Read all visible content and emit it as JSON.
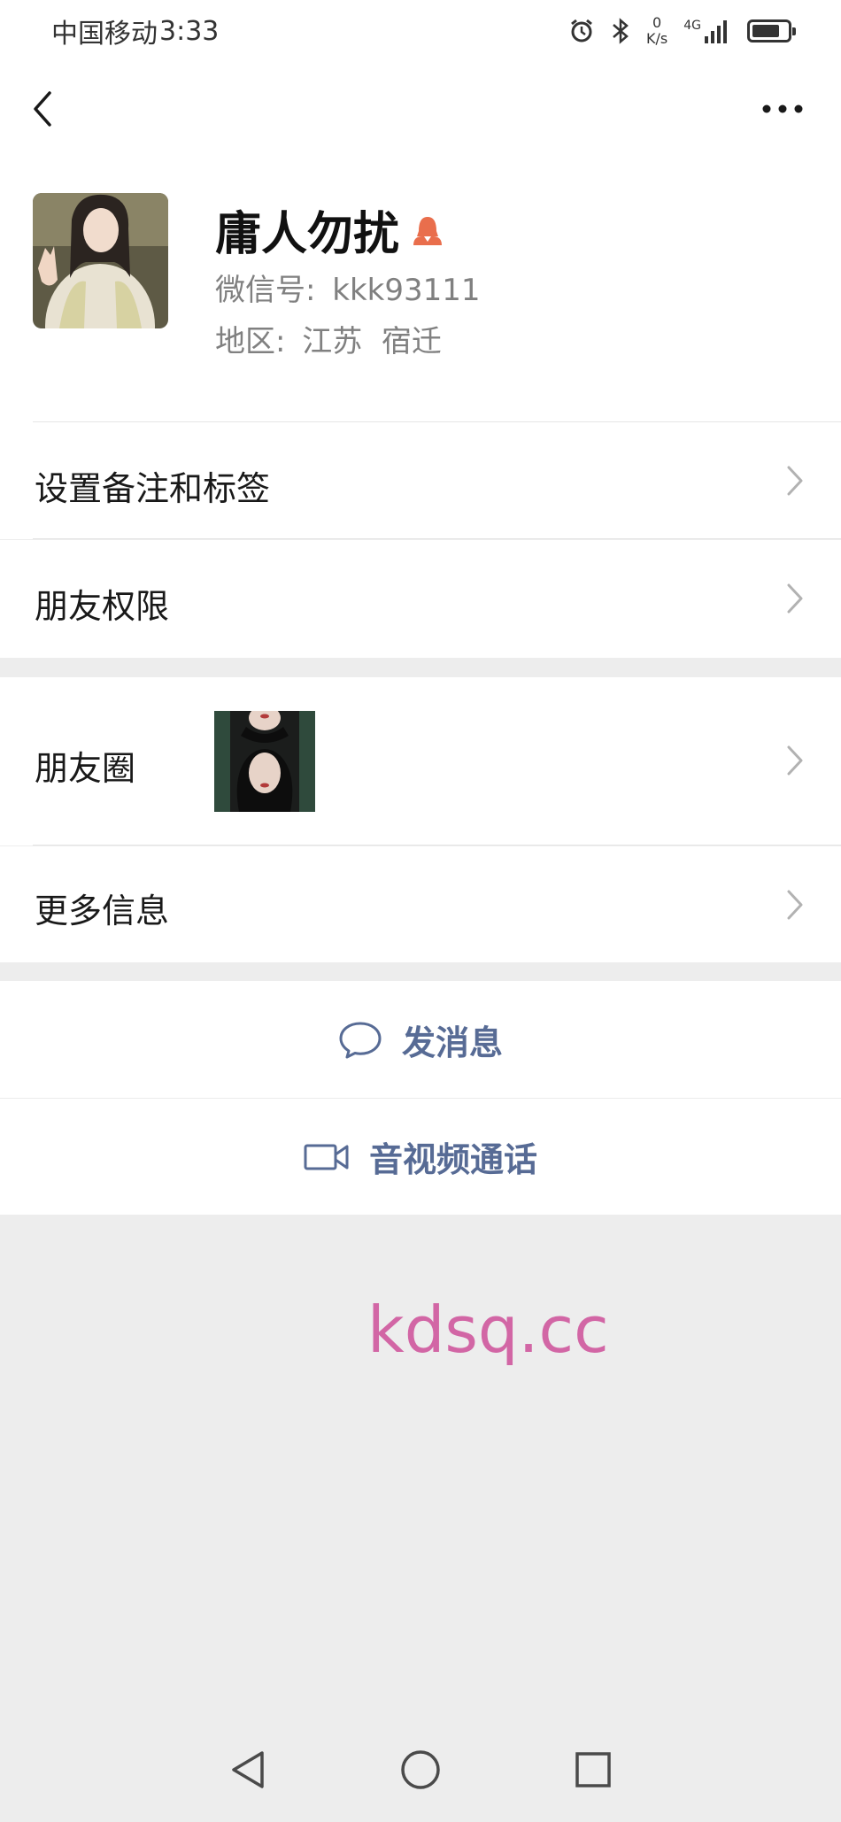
{
  "status_bar": {
    "carrier": "中国移动",
    "time": "3:33",
    "net_speed_value": "0",
    "net_speed_unit": "K/s",
    "network_type": "4G",
    "battery_level": 0.8
  },
  "nav": {
    "back_icon": "chevron-left-icon",
    "more_icon": "more-dots-icon"
  },
  "profile": {
    "name": "庸人勿扰",
    "wechat_id_label": "微信号:",
    "wechat_id": "kkk93111",
    "region_label": "地区:",
    "region": "江苏  宿迁",
    "gender_icon": "female-user-icon",
    "gender_color": "#e96e4c"
  },
  "menu": {
    "remark_tags": "设置备注和标签",
    "friend_permissions": "朋友权限",
    "moments": "朋友圈",
    "more_info": "更多信息"
  },
  "actions": {
    "send_message": "发消息",
    "video_call": "音视频通话"
  },
  "watermark": "kdsq.cc",
  "colors": {
    "link_blue": "#576b95",
    "background": "#ededed",
    "watermark": "#d266a5"
  }
}
